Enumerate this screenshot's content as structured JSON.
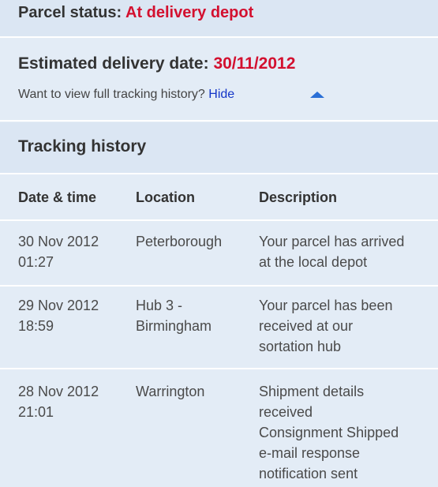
{
  "parcel_status": {
    "label": "Parcel status:",
    "value": "At delivery depot"
  },
  "estimated_delivery": {
    "label": "Estimated delivery date:",
    "value": "30/11/2012",
    "history_prompt": "Want to view full tracking history?",
    "hide_link": "Hide",
    "toggle_icon": "triangle-up-icon"
  },
  "tracking_history": {
    "title": "Tracking history",
    "columns": [
      "Date & time",
      "Location",
      "Description"
    ],
    "rows": [
      {
        "date": "30 Nov 2012",
        "time": "01:27",
        "location_1": "Peterborough",
        "location_2": "",
        "desc_1": "Your parcel has arrived",
        "desc_2": "at the local depot",
        "desc_3": "",
        "desc_4": "",
        "desc_5": ""
      },
      {
        "date": "29 Nov 2012",
        "time": "18:59",
        "location_1": "Hub 3 -",
        "location_2": "Birmingham",
        "desc_1": "Your parcel has been",
        "desc_2": "received at our",
        "desc_3": "sortation hub",
        "desc_4": "",
        "desc_5": ""
      },
      {
        "date": "28 Nov 2012",
        "time": "21:01",
        "location_1": "Warrington",
        "location_2": "",
        "desc_1": "Shipment details",
        "desc_2": "received",
        "desc_3": "Consignment Shipped",
        "desc_4": "e-mail response",
        "desc_5": "notification sent"
      }
    ]
  },
  "colors": {
    "accent_red": "#d3102f",
    "link_blue": "#1436c8",
    "panel_bg": "#e3ecf6",
    "header_bg": "#dbe6f3"
  }
}
